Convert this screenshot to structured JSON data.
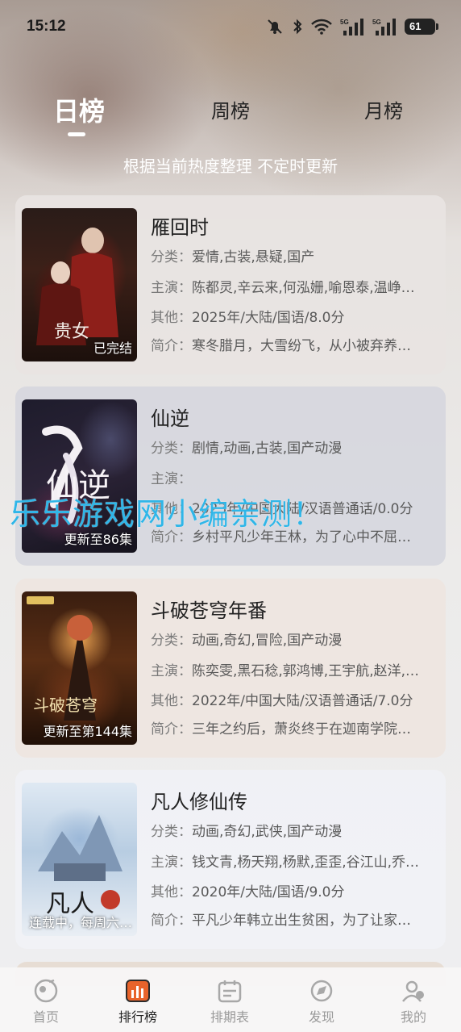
{
  "status_bar": {
    "time": "15:12",
    "signal1_label": "5G",
    "signal2_label": "5G",
    "battery": "61"
  },
  "tabs": [
    {
      "label": "日榜",
      "active": true
    },
    {
      "label": "周榜",
      "active": false
    },
    {
      "label": "月榜",
      "active": false
    }
  ],
  "subtitle": "根据当前热度整理 不定时更新",
  "items": [
    {
      "title": "雁回时",
      "poster_badge": "已完结",
      "poster_title_art": "贵女",
      "category_key": "分类：",
      "category": "爱情,古装,悬疑,国产",
      "cast_key": "主演：",
      "cast": "陈都灵,辛云来,何泓姗,喻恩泰,温峥…",
      "other_key": "其他：",
      "other": "2025年/大陆/国语/8.0分",
      "intro_key": "简介：",
      "intro": "寒冬腊月，大雪纷飞，从小被弃养…"
    },
    {
      "title": "仙逆",
      "poster_badge": "更新至86集",
      "poster_title_art": "仙逆",
      "category_key": "分类：",
      "category": "剧情,动画,古装,国产动漫",
      "cast_key": "主演：",
      "cast": "",
      "other_key": "其他：",
      "other": "2023年/中国大陆/汉语普通话/0.0分",
      "intro_key": "简介：",
      "intro": "乡村平凡少年王林，为了心中不屈…"
    },
    {
      "title": "斗破苍穹年番",
      "poster_badge": "更新至第144集",
      "poster_title_art": "斗破苍穹",
      "category_key": "分类：",
      "category": "动画,奇幻,冒险,国产动漫",
      "cast_key": "主演：",
      "cast": "陈奕雯,黑石稔,郭鸿博,王宇航,赵洋,…",
      "other_key": "其他：",
      "other": "2022年/中国大陆/汉语普通话/7.0分",
      "intro_key": "简介：",
      "intro": "三年之约后，萧炎终于在迦南学院…"
    },
    {
      "title": "凡人修仙传",
      "poster_badge": "连载中，每周六…",
      "poster_title_art": "凡人",
      "category_key": "分类：",
      "category": "动画,奇幻,武侠,国产动漫",
      "cast_key": "主演：",
      "cast": "钱文青,杨天翔,杨默,歪歪,谷江山,乔…",
      "other_key": "其他：",
      "other": "2020年/大陆/国语/9.0分",
      "intro_key": "简介：",
      "intro": "平凡少年韩立出生贫困，为了让家…"
    }
  ],
  "watermark": "乐乐游戏网小编亲测！",
  "bottom_nav": [
    {
      "label": "首页",
      "icon": "home-icon",
      "active": false
    },
    {
      "label": "排行榜",
      "icon": "ranking-icon",
      "active": true
    },
    {
      "label": "排期表",
      "icon": "schedule-icon",
      "active": false
    },
    {
      "label": "发现",
      "icon": "discover-icon",
      "active": false
    },
    {
      "label": "我的",
      "icon": "profile-icon",
      "active": false
    }
  ],
  "colors": {
    "accent": "#e8632b",
    "watermark": "#2fb6e8"
  }
}
